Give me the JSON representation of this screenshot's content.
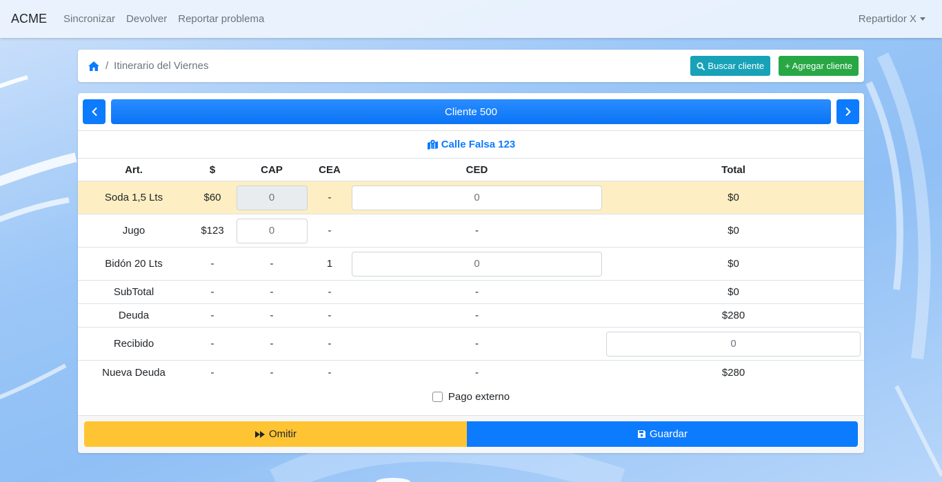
{
  "navbar": {
    "brand": "ACME",
    "links": [
      "Sincronizar",
      "Devolver",
      "Reportar problema"
    ],
    "user": "Repartidor X"
  },
  "breadcrumb": {
    "home_icon": "home-icon",
    "separator": "/",
    "current": "Itinerario del Viernes",
    "search_button": "Buscar cliente",
    "add_button": "+ Agregar cliente"
  },
  "client": {
    "name": "Cliente 500",
    "address": "Calle Falsa 123",
    "address_icon": "map-marked-icon"
  },
  "table": {
    "headers": [
      "Art.",
      "$",
      "CAP",
      "CEA",
      "CED",
      "Total"
    ],
    "rows": [
      {
        "art": "Soda 1,5 Lts",
        "price": "$60",
        "cap": "0",
        "cea": "-",
        "ced": "0",
        "total": "$0"
      },
      {
        "art": "Jugo",
        "price": "$123",
        "cap": "0",
        "cea": "-",
        "ced": "-",
        "total": "$0"
      },
      {
        "art": "Bidón 20 Lts",
        "price": "-",
        "cap": "-",
        "cea": "1",
        "ced": "0",
        "total": "$0"
      },
      {
        "art": "SubTotal",
        "price": "-",
        "cap": "-",
        "cea": "-",
        "ced": "-",
        "total": "$0"
      },
      {
        "art": "Deuda",
        "price": "-",
        "cap": "-",
        "cea": "-",
        "ced": "-",
        "total": "$280"
      },
      {
        "art": "Recibido",
        "price": "-",
        "cap": "-",
        "cea": "-",
        "ced": "-",
        "total": "0"
      },
      {
        "art": "Nueva Deuda",
        "price": "-",
        "cap": "-",
        "cea": "-",
        "ced": "-",
        "total": "$280"
      }
    ]
  },
  "external_payment": {
    "label": "Pago externo",
    "checked": false
  },
  "footer": {
    "omit_label": "Omitir",
    "save_label": "Guardar"
  },
  "colors": {
    "primary": "#0d7bfd",
    "info": "#17a2b8",
    "success": "#28a745",
    "warning": "#ffc433",
    "highlight_row": "#fdefc3"
  }
}
